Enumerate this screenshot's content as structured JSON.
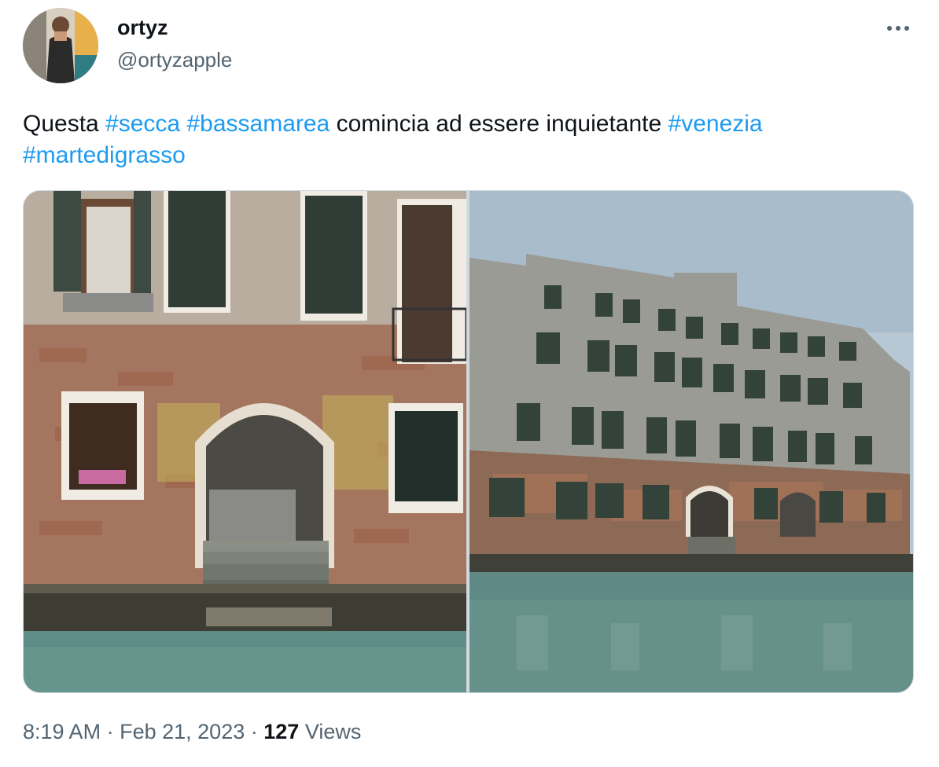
{
  "author": {
    "name": "ortyz",
    "handle": "@ortyzapple",
    "avatar_icon": "person-photo-avatar"
  },
  "menu": {
    "icon": "more-dots-icon"
  },
  "tweet": {
    "segments": [
      {
        "type": "text",
        "value": "Questa "
      },
      {
        "type": "tag",
        "value": "#secca"
      },
      {
        "type": "text",
        "value": " "
      },
      {
        "type": "tag",
        "value": "#bassamarea"
      },
      {
        "type": "text",
        "value": " comincia ad essere inquietante "
      },
      {
        "type": "tag",
        "value": "#venezia"
      },
      {
        "type": "text",
        "value": " "
      },
      {
        "type": "tag",
        "value": "#martedigrasso"
      }
    ],
    "link_color": "#1d9bf0"
  },
  "media": {
    "photos": [
      {
        "subject": "venetian-archway-low-tide-photo"
      },
      {
        "subject": "venetian-palazzo-canal-photo"
      }
    ]
  },
  "meta": {
    "time": "8:19 AM",
    "separator": "·",
    "date": "Feb 21, 2023",
    "views_count": "127",
    "views_label": "Views"
  }
}
